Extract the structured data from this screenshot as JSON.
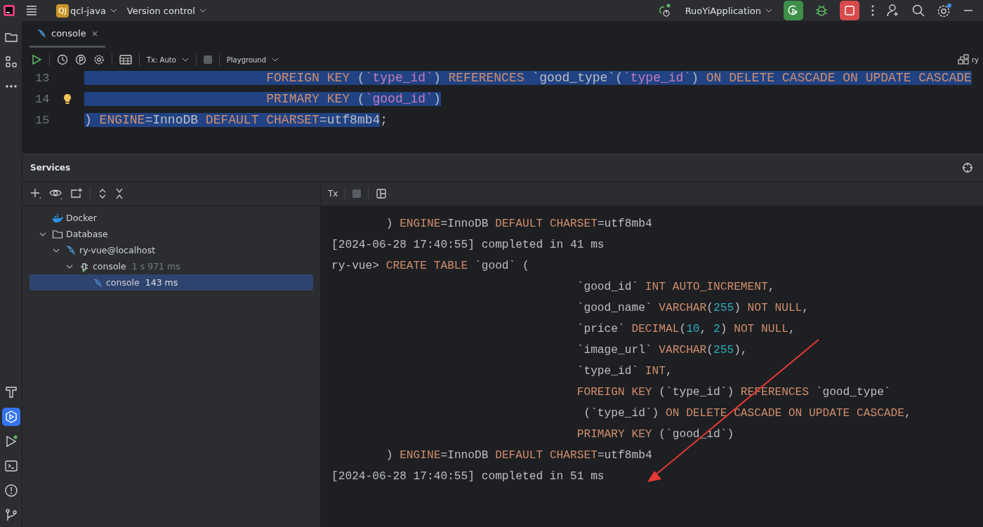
{
  "title_bar": {
    "project_badge": "QJ",
    "project": "qcl-java",
    "vcs": "Version control",
    "run_config": "RuoYiApplication"
  },
  "tool_strip_top": [
    {
      "kind": "project",
      "selected": false
    },
    {
      "kind": "structure",
      "selected": false
    },
    {
      "kind": "more",
      "selected": false
    }
  ],
  "tool_strip_bottom": [
    {
      "kind": "build",
      "selected": false
    },
    {
      "kind": "services",
      "selected": true
    },
    {
      "kind": "run",
      "selected": false
    },
    {
      "kind": "terminal",
      "selected": false
    },
    {
      "kind": "problems",
      "selected": false
    },
    {
      "kind": "git",
      "selected": false
    }
  ],
  "editor": {
    "tabs": [
      {
        "label": "console",
        "selected": true
      }
    ],
    "toolbar": {
      "tx_mode": "Tx: Auto",
      "mode": "Playground",
      "datasource": "ry"
    },
    "lines": [
      {
        "number": "13",
        "bulb": false,
        "tokens": [
          {
            "text": "                        FOREIGN KEY",
            "kind": "kw",
            "selected": true
          },
          {
            "text": " (",
            "kind": "plain",
            "selected": true
          },
          {
            "text": "`type_id`",
            "kind": "id",
            "selected": true
          },
          {
            "text": ") ",
            "kind": "plain",
            "selected": true
          },
          {
            "text": "REFERENCES",
            "kind": "kw",
            "selected": true
          },
          {
            "text": " `good_type`(",
            "kind": "plain",
            "selected": true
          },
          {
            "text": "`type_id`",
            "kind": "id",
            "selected": true
          },
          {
            "text": ") ",
            "kind": "plain",
            "selected": true
          },
          {
            "text": "ON DELETE CASCADE ON UPDATE CASCADE",
            "kind": "kw",
            "selected": true
          }
        ]
      },
      {
        "number": "14",
        "bulb": true,
        "tokens": [
          {
            "text": "                        PRIMARY KEY",
            "kind": "kw",
            "selected": true
          },
          {
            "text": " (",
            "kind": "plain",
            "selected": true
          },
          {
            "text": "`good_id`",
            "kind": "id",
            "selected": true
          },
          {
            "text": ")",
            "kind": "plain",
            "selected": true
          }
        ]
      },
      {
        "number": "15",
        "bulb": false,
        "tokens": [
          {
            "text": ") ",
            "kind": "plain",
            "selected": true
          },
          {
            "text": "ENGINE",
            "kind": "kw",
            "selected": true
          },
          {
            "text": "=InnoDB ",
            "kind": "plain",
            "selected": true
          },
          {
            "text": "DEFAULT CHARSET",
            "kind": "kw",
            "selected": true
          },
          {
            "text": "=utf8mb4",
            "kind": "plain",
            "selected": true
          },
          {
            "text": ";",
            "kind": "plain",
            "selected": false
          }
        ]
      }
    ]
  },
  "services": {
    "title": "Services",
    "tree": [
      {
        "label": "Docker",
        "kind": "docker",
        "selected": false
      },
      {
        "label": "Database",
        "kind": "folder",
        "selected": false,
        "expanded": true,
        "children": [
          {
            "label": "ry-vue@localhost",
            "kind": "datasource",
            "selected": false,
            "expanded": true,
            "children": [
              {
                "label": "console",
                "detail": "1 s 971 ms",
                "kind": "session",
                "selected": false,
                "expanded": true,
                "children": [
                  {
                    "label": "console",
                    "detail": "143 ms",
                    "kind": "console",
                    "selected": true
                  }
                ]
              }
            ]
          }
        ]
      }
    ],
    "console_tx": "Tx",
    "output": [
      [
        {
          "text": "        ) ",
          "kind": "plain"
        },
        {
          "text": "ENGINE",
          "kind": "kw"
        },
        {
          "text": "=InnoDB ",
          "kind": "plain"
        },
        {
          "text": "DEFAULT CHARSET",
          "kind": "kw"
        },
        {
          "text": "=utf8mb4",
          "kind": "plain"
        }
      ],
      [
        {
          "text": "[2024-06-28 17:40:55] completed in 41 ms",
          "kind": "plain"
        }
      ],
      [
        {
          "text": "ry-vue> ",
          "kind": "plain"
        },
        {
          "text": "CREATE TABLE",
          "kind": "kw"
        },
        {
          "text": " `good` (",
          "kind": "plain"
        }
      ],
      [
        {
          "text": "                                    `good_id` ",
          "kind": "plain"
        },
        {
          "text": "INT AUTO_INCREMENT",
          "kind": "kw"
        },
        {
          "text": ",",
          "kind": "plain"
        }
      ],
      [
        {
          "text": "                                    `good_name` ",
          "kind": "plain"
        },
        {
          "text": "VARCHAR",
          "kind": "kw"
        },
        {
          "text": "(",
          "kind": "plain"
        },
        {
          "text": "255",
          "kind": "num"
        },
        {
          "text": ") ",
          "kind": "plain"
        },
        {
          "text": "NOT NULL",
          "kind": "kw"
        },
        {
          "text": ",",
          "kind": "plain"
        }
      ],
      [
        {
          "text": "                                    `price` ",
          "kind": "plain"
        },
        {
          "text": "DECIMAL",
          "kind": "kw"
        },
        {
          "text": "(",
          "kind": "plain"
        },
        {
          "text": "10",
          "kind": "num"
        },
        {
          "text": ", ",
          "kind": "plain"
        },
        {
          "text": "2",
          "kind": "num"
        },
        {
          "text": ") ",
          "kind": "plain"
        },
        {
          "text": "NOT NULL",
          "kind": "kw"
        },
        {
          "text": ",",
          "kind": "plain"
        }
      ],
      [
        {
          "text": "                                    `image_url` ",
          "kind": "plain"
        },
        {
          "text": "VARCHAR",
          "kind": "kw"
        },
        {
          "text": "(",
          "kind": "plain"
        },
        {
          "text": "255",
          "kind": "num"
        },
        {
          "text": "),",
          "kind": "plain"
        }
      ],
      [
        {
          "text": "                                    `type_id` ",
          "kind": "plain"
        },
        {
          "text": "INT",
          "kind": "kw"
        },
        {
          "text": ",",
          "kind": "plain"
        }
      ],
      [
        {
          "text": "                                    FOREIGN KEY",
          "kind": "kw"
        },
        {
          "text": " (`type_id`) ",
          "kind": "plain"
        },
        {
          "text": "REFERENCES",
          "kind": "kw"
        },
        {
          "text": " `good_type`",
          "kind": "plain"
        }
      ],
      [
        {
          "text": "                                     (`type_id`) ",
          "kind": "plain"
        },
        {
          "text": "ON DELETE CASCADE ON UPDATE CASCADE",
          "kind": "kw"
        },
        {
          "text": ",",
          "kind": "plain"
        }
      ],
      [
        {
          "text": "                                    PRIMARY KEY",
          "kind": "kw"
        },
        {
          "text": " (`good_id`)",
          "kind": "plain"
        }
      ],
      [
        {
          "text": "        ) ",
          "kind": "plain"
        },
        {
          "text": "ENGINE",
          "kind": "kw"
        },
        {
          "text": "=InnoDB ",
          "kind": "plain"
        },
        {
          "text": "DEFAULT CHARSET",
          "kind": "kw"
        },
        {
          "text": "=utf8mb4",
          "kind": "plain"
        }
      ],
      [
        {
          "text": "[2024-06-28 17:40:55] completed in 51 ms",
          "kind": "plain"
        }
      ]
    ]
  }
}
